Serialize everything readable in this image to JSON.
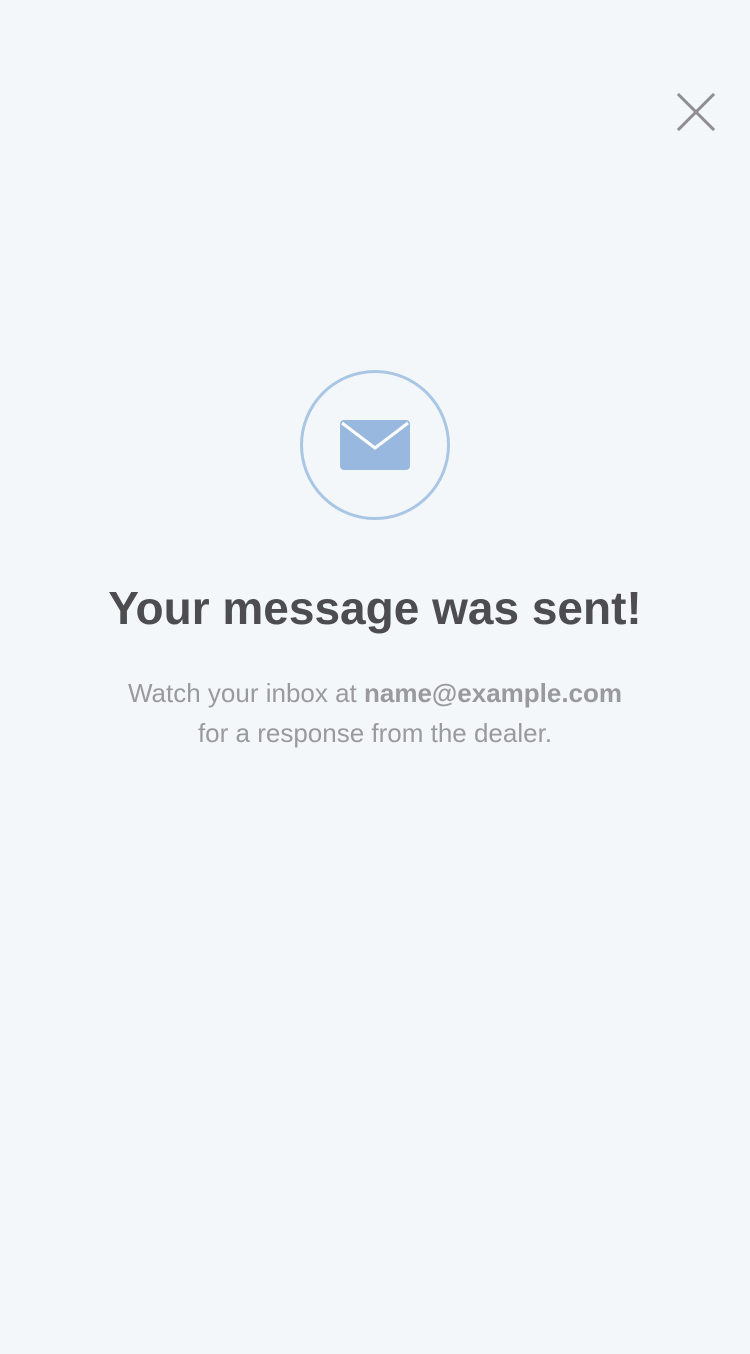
{
  "colors": {
    "background": "#f4f7fa",
    "accent": "#99b8df",
    "circle_border": "#a9c6e5",
    "title": "#4d4d4f",
    "body_text": "#9a9a9c",
    "close_icon": "#8f8f91"
  },
  "icons": {
    "close": "close-icon",
    "envelope": "envelope-icon"
  },
  "confirmation": {
    "title": "Your message was sent!",
    "line1_prefix": "Watch your inbox at ",
    "email": "name@example.com",
    "line2": "for a response from the dealer."
  }
}
